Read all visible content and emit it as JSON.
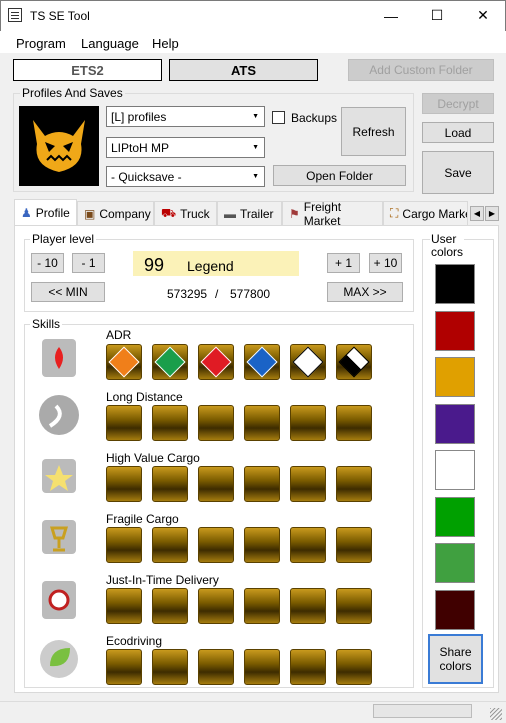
{
  "window": {
    "title": "TS SE Tool",
    "minimize": "—",
    "maximize": "☐",
    "close": "✕"
  },
  "menu": [
    "Program",
    "Language",
    "Help"
  ],
  "game_tabs": {
    "ets2": "ETS2",
    "ats": "ATS",
    "add_custom_folder": "Add Custom Folder"
  },
  "profiles": {
    "group_label": "Profiles And Saves",
    "profile": "[L] profiles",
    "save": "LIPtoH MP",
    "quicksave": "- Quicksave -",
    "backups": "Backups",
    "refresh": "Refresh",
    "open_folder": "Open Folder"
  },
  "actions": {
    "decrypt": "Decrypt",
    "load": "Load",
    "save": "Save"
  },
  "tabs": [
    "Profile",
    "Company",
    "Truck",
    "Trailer",
    "Freight Market",
    "Cargo Market"
  ],
  "player_level": {
    "group_label": "Player level",
    "minus10": "- 10",
    "minus1": "- 1",
    "level": "99",
    "level_name": "Legend",
    "plus1": "+ 1",
    "plus10": "+ 10",
    "min": "<< MIN",
    "max": "MAX >>",
    "xp_current": "573295",
    "xp_sep": "/",
    "xp_max": "577800"
  },
  "skills": {
    "group_label": "Skills",
    "rows": [
      {
        "name": "ADR",
        "levels": 6
      },
      {
        "name": "Long Distance",
        "levels": 6
      },
      {
        "name": "High Value Cargo",
        "levels": 6
      },
      {
        "name": "Fragile Cargo",
        "levels": 6
      },
      {
        "name": "Just-In-Time Delivery",
        "levels": 6
      },
      {
        "name": "Ecodriving",
        "levels": 6
      }
    ],
    "adr_labels": [
      "EXPLOSIVE",
      "NON-FLAMMABLE GAS",
      "",
      "",
      "",
      "CORROSIVE"
    ],
    "adr_colors": [
      "#f07f1a",
      "#1a9e4b",
      "#e01b24",
      "#1a63c6",
      "#ffffff",
      "#ffffff"
    ]
  },
  "user_colors": {
    "label_line1": "User",
    "label_line2": "colors",
    "colors": [
      "#000000",
      "#b00000",
      "#e0a000",
      "#4a1a8c",
      "#ffffff",
      "#00a000",
      "#40a040",
      "#400000"
    ],
    "share_line1": "Share",
    "share_line2": "colors"
  }
}
